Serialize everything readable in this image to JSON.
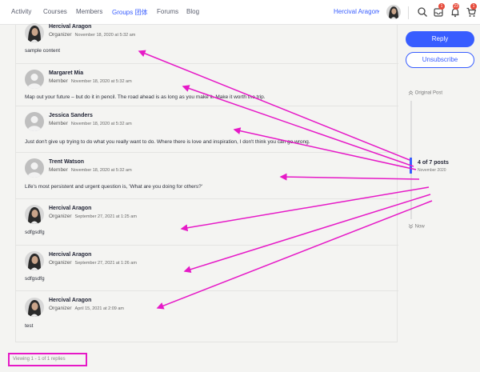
{
  "nav": {
    "items": [
      {
        "label": "Activity",
        "active": false
      },
      {
        "label": "Courses",
        "active": false
      },
      {
        "label": "Members",
        "active": false
      },
      {
        "label": "Groups 团体",
        "active": true
      },
      {
        "label": "Forums",
        "active": false
      },
      {
        "label": "Blog",
        "active": false
      }
    ],
    "user_name": "Hercival Aragon",
    "chevron": "⌄",
    "badges": {
      "messages": "1",
      "notifications": "23",
      "cart": "1"
    }
  },
  "replies": [
    {
      "author": "Hercival Aragon",
      "role": "Organizer",
      "date": "November 18, 2020 at 5:32 am",
      "content": "sample content",
      "avatar": "photo"
    },
    {
      "author": "Margaret Mia",
      "role": "Member",
      "date": "November 18, 2020 at 5:32 am",
      "content": "Map out your future – but do it in pencil. The road ahead is as long as you make it. Make it worth the trip.",
      "avatar": "placeholder"
    },
    {
      "author": "Jessica Sanders",
      "role": "Member",
      "date": "November 18, 2020 at 5:32 am",
      "content": "Just don't give up trying to do what you really want to do. Where there is love and inspiration, I don't think you can go wrong.",
      "avatar": "placeholder"
    },
    {
      "author": "Trent Watson",
      "role": "Member",
      "date": "November 18, 2020 at 5:32 am",
      "content": "Life's most persistent and urgent question is, 'What are you doing for others?'",
      "avatar": "placeholder"
    },
    {
      "author": "Hercival Aragon",
      "role": "Organizer",
      "date": "September 27, 2021 at 1:25 am",
      "content": "sdfgsdfg",
      "avatar": "photo"
    },
    {
      "author": "Hercival Aragon",
      "role": "Organizer",
      "date": "September 27, 2021 at 1:26 am",
      "content": "sdfgsdfg",
      "avatar": "photo"
    },
    {
      "author": "Hercival Aragon",
      "role": "Organizer",
      "date": "April 15, 2021 at 2:09 am",
      "content": "test",
      "avatar": "photo"
    }
  ],
  "viewing_text": "Viewing 1 - 1 of 1 replies",
  "sidebar": {
    "reply_label": "Reply",
    "unsubscribe_label": "Unsubscribe",
    "original_post_label": "Original Post",
    "position_text": "4 of 7 posts",
    "position_date": "November 2020",
    "now_label": "Now"
  },
  "colors": {
    "accent": "#385dff",
    "annotation": "#e619c7",
    "badge": "#e74c3c"
  },
  "icons": [
    "search-icon",
    "inbox-icon",
    "bell-icon",
    "cart-icon",
    "chevron-up-icon",
    "chevron-down-icon"
  ]
}
